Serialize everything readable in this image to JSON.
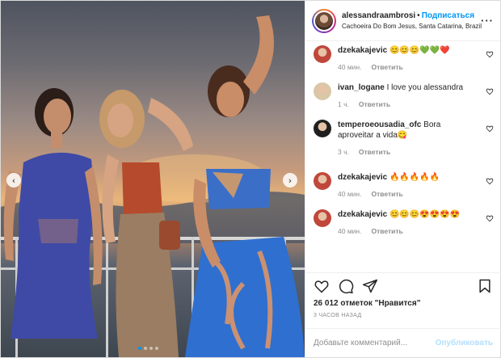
{
  "post": {
    "author": "alessandraambrosi",
    "separator": "•",
    "follow_label": "Подписаться",
    "location": "Cachoeira Do Bom Jesus, Santa Catarina, Brazil",
    "more_icon": "more-horizontal-icon"
  },
  "photo": {
    "prev_icon": "chevron-left-icon",
    "next_icon": "chevron-right-icon",
    "prev_glyph": "‹",
    "next_glyph": "›",
    "carousel_count": 4,
    "carousel_active": 1
  },
  "comments": [
    {
      "user": "dzekakajevic",
      "text": "😊😊😊💚💚❤️",
      "age": "40 мин.",
      "reply": "Ответить",
      "avatar_color": "#c0473c"
    },
    {
      "user": "ivan_logane",
      "text": "I love you alessandra",
      "age": "1 ч.",
      "reply": "Ответить",
      "avatar_color": "#d9c7a8"
    },
    {
      "user": "temperoeousadia_ofc",
      "text": "Bora aproveitar a vida😋",
      "age": "3 ч.",
      "reply": "Ответить",
      "avatar_color": "#1f1f1f"
    },
    {
      "user": "dzekakajevic",
      "text": "🔥🔥🔥🔥🔥",
      "age": "40 мин.",
      "reply": "Ответить",
      "avatar_color": "#c0473c"
    },
    {
      "user": "dzekakajevic",
      "text": "😊😊😊😍😍😍😍",
      "age": "40 мин.",
      "reply": "Ответить",
      "avatar_color": "#c0473c"
    }
  ],
  "actions": {
    "like_icon": "heart-icon",
    "comment_icon": "comment-icon",
    "share_icon": "share-icon",
    "save_icon": "bookmark-icon"
  },
  "likes_text": "26 012 отметок \"Нравится\"",
  "posted_ago": "3 ЧАСОВ НАЗАД",
  "add_comment": {
    "placeholder": "Добавьте комментарий...",
    "publish_label": "Опубликовать"
  },
  "colors": {
    "link": "#0095f6",
    "publish_disabled": "#b2dffc",
    "muted": "#8e8e8e",
    "text": "#262626"
  }
}
